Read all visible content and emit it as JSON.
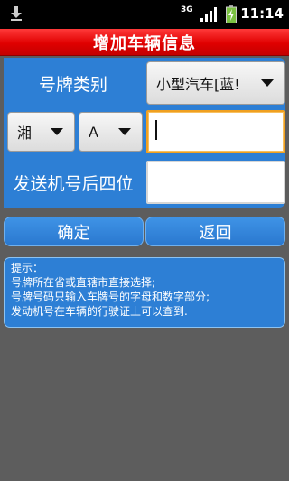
{
  "status_bar": {
    "network_type": "3G",
    "time": "11:14",
    "icons": [
      "download-icon",
      "signal-icon",
      "battery-icon"
    ]
  },
  "title": "增加车辆信息",
  "form": {
    "plate_type_label": "号牌类别",
    "plate_type_value": "小型汽车[蓝!",
    "province_value": "湘",
    "city_letter_value": "A",
    "plate_number_value": "",
    "engine_label": "发送机号后四位",
    "engine_value": ""
  },
  "buttons": {
    "confirm": "确定",
    "back": "返回"
  },
  "hint": {
    "heading": "提示：",
    "lines": [
      "号牌所在省或直辖市直接选择;",
      "号牌号码只输入车牌号的字母和数字部分;",
      "发动机号在车辆的行驶证上可以查到."
    ]
  },
  "colors": {
    "title_bar": "#e00000",
    "panel_blue": "#2d7fd5",
    "background": "#5d5d5d",
    "focus_border": "#f0a020"
  }
}
